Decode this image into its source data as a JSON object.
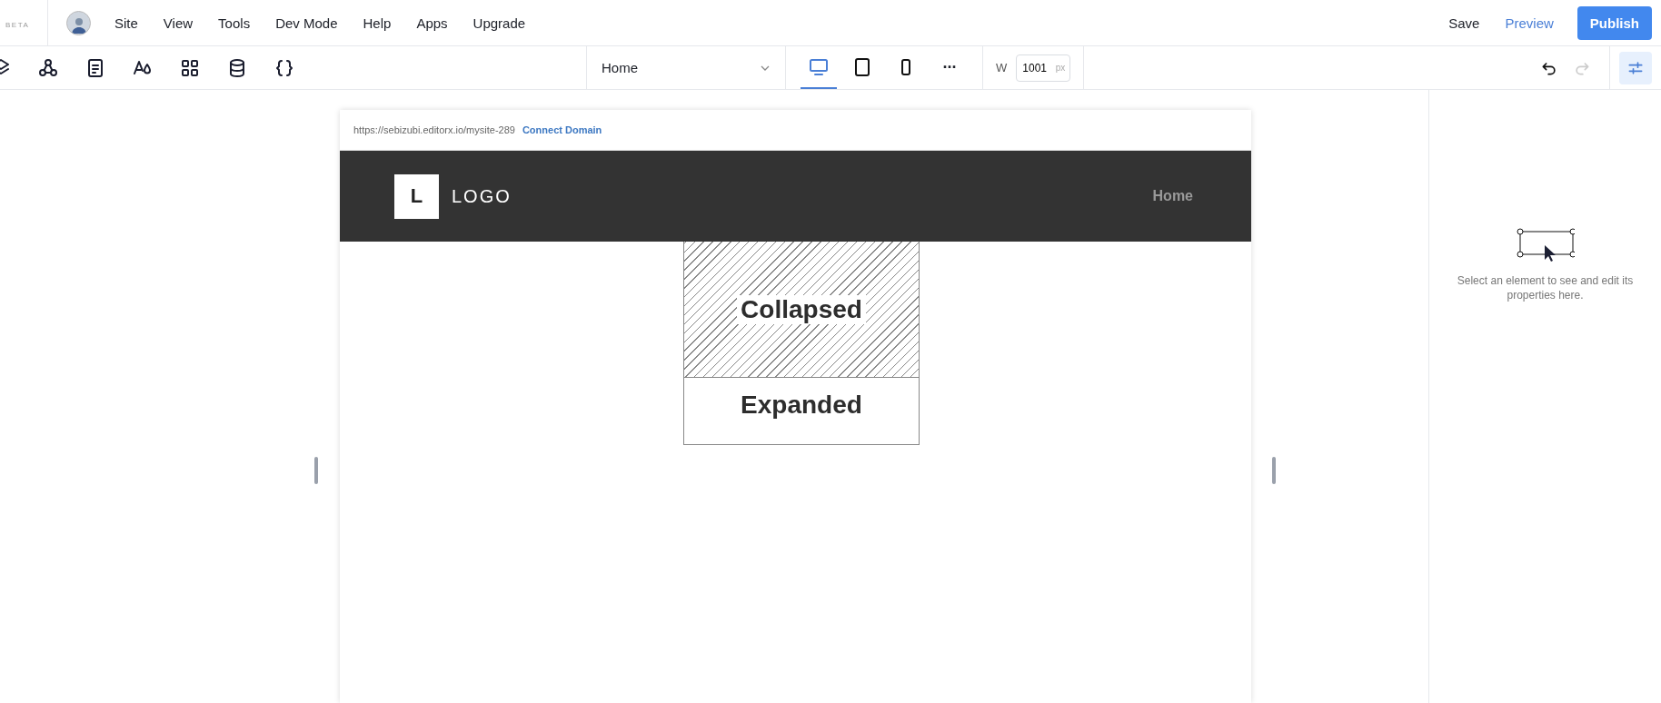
{
  "top_bar": {
    "badge": "BETA",
    "menu": [
      "Site",
      "View",
      "Tools",
      "Dev Mode",
      "Help",
      "Apps",
      "Upgrade"
    ],
    "actions": [
      {
        "label": "Save",
        "kind": "plain"
      },
      {
        "label": "Preview",
        "kind": "link"
      },
      {
        "label": "Publish",
        "kind": "primary"
      }
    ]
  },
  "toolbar": {
    "page_selector": {
      "value": "Home"
    },
    "devices": [
      {
        "kind": "desktop",
        "selected": true
      },
      {
        "kind": "tablet",
        "selected": false
      },
      {
        "kind": "mobile",
        "selected": false
      }
    ],
    "more": "···",
    "width": {
      "label": "W",
      "value": "1001",
      "unit": "px"
    },
    "history": [
      {
        "kind": "undo",
        "disabled": false
      },
      {
        "kind": "redo",
        "disabled": true
      }
    ],
    "panel_toggle": {
      "on": true
    }
  },
  "canvas": {
    "url": "https://sebizubi.editorx.io/mysite-289",
    "connect_link": "Connect Domain",
    "header": {
      "logo_letter": "L",
      "logo_text": "LOGO",
      "nav": [
        "Home"
      ]
    },
    "sections": [
      {
        "kind": "collapsed",
        "label": "Collapsed"
      },
      {
        "kind": "expanded",
        "label": "Expanded"
      }
    ]
  },
  "properties_panel": {
    "hint": "Select an element to see and edit its properties here."
  }
}
